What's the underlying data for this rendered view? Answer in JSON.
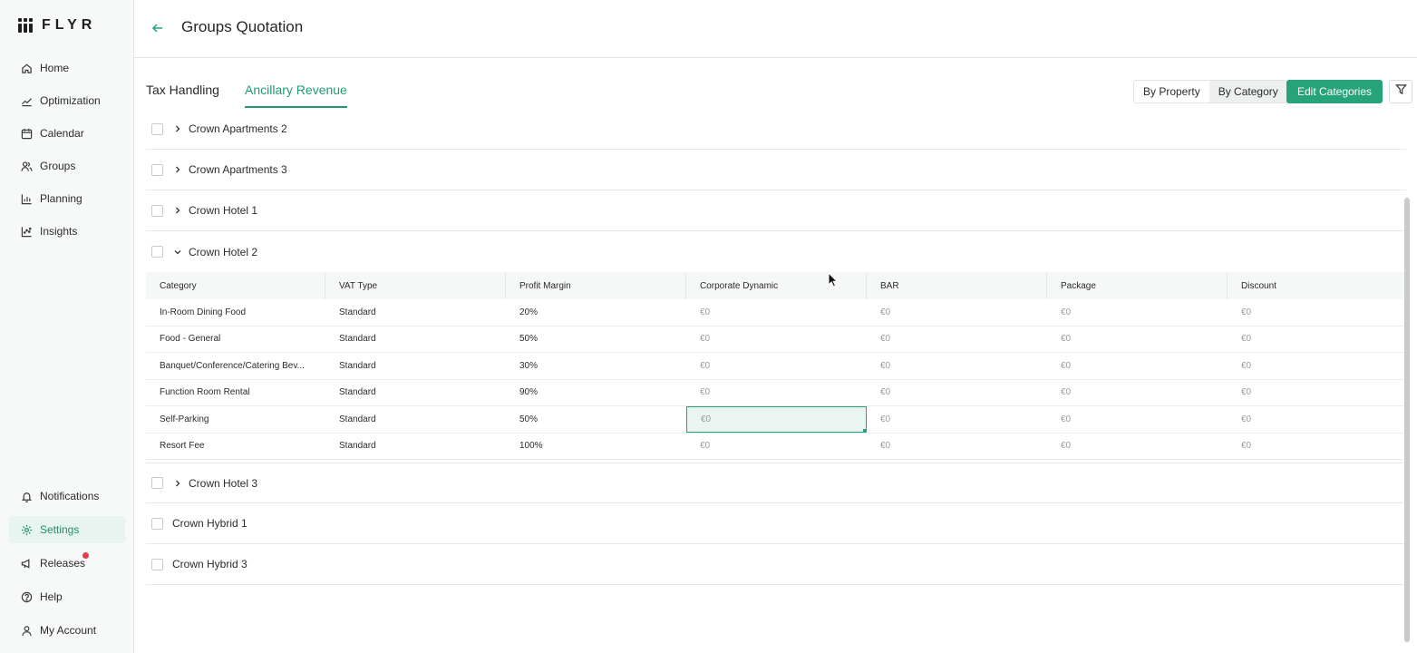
{
  "brand": {
    "name": "FLYR"
  },
  "sidebar": {
    "items": [
      {
        "label": "Home",
        "icon": "home-icon"
      },
      {
        "label": "Optimization",
        "icon": "trend-icon"
      },
      {
        "label": "Calendar",
        "icon": "calendar-icon"
      },
      {
        "label": "Groups",
        "icon": "groups-icon"
      },
      {
        "label": "Planning",
        "icon": "bar-chart-icon"
      },
      {
        "label": "Insights",
        "icon": "insights-icon"
      }
    ],
    "bottom_items": [
      {
        "label": "Notifications",
        "icon": "bell-icon"
      },
      {
        "label": "Settings",
        "icon": "gear-icon",
        "active": true
      },
      {
        "label": "Releases",
        "icon": "megaphone-icon",
        "has_badge": true
      },
      {
        "label": "Help",
        "icon": "help-icon"
      },
      {
        "label": "My Account",
        "icon": "user-icon"
      }
    ]
  },
  "header": {
    "title": "Groups Quotation"
  },
  "tabs": [
    {
      "label": "Tax Handling",
      "active": false
    },
    {
      "label": "Ancillary Revenue",
      "active": true
    }
  ],
  "view_toggle": {
    "by_property": "By Property",
    "by_category": "By Category",
    "selected": "By Category"
  },
  "edit_categories_label": "Edit Categories",
  "properties": [
    {
      "name": "Crown Apartments 2",
      "expandable": true,
      "expanded": false
    },
    {
      "name": "Crown Apartments 3",
      "expandable": true,
      "expanded": false
    },
    {
      "name": "Crown Hotel 1",
      "expandable": true,
      "expanded": false
    },
    {
      "name": "Crown Hotel 2",
      "expandable": true,
      "expanded": true
    },
    {
      "name": "Crown Hotel 3",
      "expandable": true,
      "expanded": false
    },
    {
      "name": "Crown Hybrid 1",
      "expandable": false,
      "expanded": false
    },
    {
      "name": "Crown Hybrid 3",
      "expandable": false,
      "expanded": false
    }
  ],
  "table": {
    "columns": [
      "Category",
      "VAT Type",
      "Profit Margin",
      "Corporate Dynamic",
      "BAR",
      "Package",
      "Discount"
    ],
    "rows": [
      [
        "In-Room Dining Food",
        "Standard",
        "20%",
        "€0",
        "€0",
        "€0",
        "€0"
      ],
      [
        "Food - General",
        "Standard",
        "50%",
        "€0",
        "€0",
        "€0",
        "€0"
      ],
      [
        "Banquet/Conference/Catering Bev...",
        "Standard",
        "30%",
        "€0",
        "€0",
        "€0",
        "€0"
      ],
      [
        "Function Room Rental",
        "Standard",
        "90%",
        "€0",
        "€0",
        "€0",
        "€0"
      ],
      [
        "Self-Parking",
        "Standard",
        "50%",
        "€0",
        "€0",
        "€0",
        "€0"
      ],
      [
        "Resort Fee",
        "Standard",
        "100%",
        "€0",
        "€0",
        "€0",
        "€0"
      ]
    ],
    "selected_cell": {
      "row": 4,
      "col": 3
    }
  },
  "colors": {
    "accent": "#27a37a",
    "accent_text": "#1f9c73",
    "badge": "#e23b4a"
  }
}
